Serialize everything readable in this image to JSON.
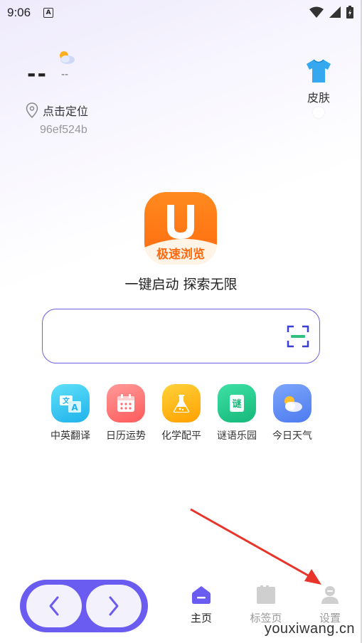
{
  "status_bar": {
    "time": "9:06",
    "notification_icon": "A"
  },
  "weather": {
    "temperature": "--",
    "description": "--"
  },
  "location": {
    "label": "点击定位",
    "device_code": "96ef524b"
  },
  "skin": {
    "label": "皮肤"
  },
  "logo": {
    "letter": "U",
    "text": "极速浏览"
  },
  "slogan": "一键启动 探索无限",
  "search": {
    "placeholder": ""
  },
  "tools": [
    {
      "label": "中英翻译",
      "color": "#38c6f0"
    },
    {
      "label": "日历运势",
      "color": "#ff6b6b"
    },
    {
      "label": "化学配平",
      "color": "#ffb400"
    },
    {
      "label": "谜语乐园",
      "color": "#22c989"
    },
    {
      "label": "今日天气",
      "color": "#5b8cf5"
    }
  ],
  "tabs": {
    "home": "主页",
    "tabs": "标签页",
    "settings": "设置"
  },
  "watermark": "youxiwang.cn",
  "colors": {
    "accent": "#6a5cf0",
    "logo": "#ff7b1c"
  }
}
